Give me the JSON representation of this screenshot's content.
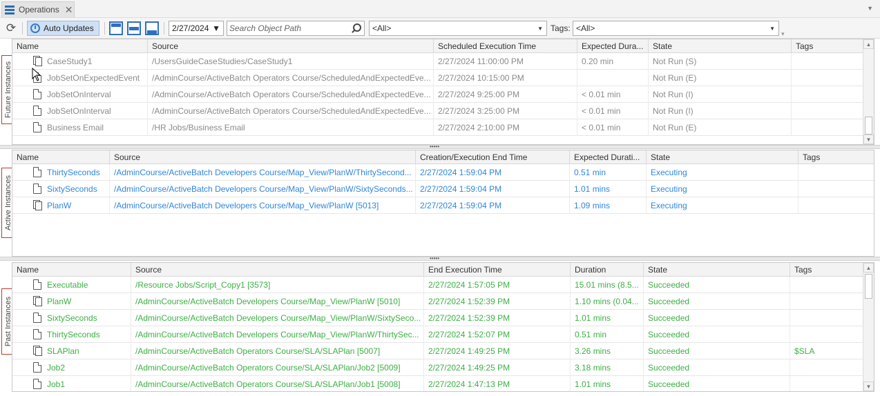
{
  "tab": {
    "title": "Operations",
    "close": "✕"
  },
  "toolbar": {
    "refresh_icon": "refresh-icon",
    "auto_updates_label": "Auto Updates",
    "date_value": "2/27/2024",
    "search_placeholder": "Search Object Path",
    "filter_value": "<All>",
    "tags_label": "Tags:",
    "tags_value": "<All>"
  },
  "future": {
    "label": "Future Instances",
    "columns": [
      "Name",
      "Source",
      "Scheduled Execution Time",
      "Expected Dura...",
      "State",
      "Tags"
    ],
    "rows": [
      {
        "icon": "plan",
        "name": "CaseStudy1",
        "source": "/UsersGuideCaseStudies/CaseStudy1",
        "time": "2/27/2024 11:00:00 PM",
        "duration": "0.20 min",
        "state": "Not Run (S)",
        "tags": ""
      },
      {
        "icon": "job",
        "name": "JobSetOnExpectedEvent",
        "source": "/AdminCourse/ActiveBatch Operators Course/ScheduledAndExpectedEve...",
        "time": "2/27/2024 10:15:00 PM",
        "duration": "",
        "state": "Not Run (E)",
        "tags": ""
      },
      {
        "icon": "job",
        "name": "JobSetOnInterval",
        "source": "/AdminCourse/ActiveBatch Operators Course/ScheduledAndExpectedEve...",
        "time": "2/27/2024 9:25:00 PM",
        "duration": "< 0.01 min",
        "state": "Not Run (I)",
        "tags": ""
      },
      {
        "icon": "job",
        "name": "JobSetOnInterval",
        "source": "/AdminCourse/ActiveBatch Operators Course/ScheduledAndExpectedEve...",
        "time": "2/27/2024 3:25:00 PM",
        "duration": "< 0.01 min",
        "state": "Not Run (I)",
        "tags": ""
      },
      {
        "icon": "job",
        "name": "Business Email",
        "source": "/HR Jobs/Business Email",
        "time": "2/27/2024 2:10:00 PM",
        "duration": "< 0.01 min",
        "state": "Not Run (E)",
        "tags": ""
      }
    ]
  },
  "active": {
    "label": "Active Instances",
    "columns": [
      "Name",
      "Source",
      "Creation/Execution End Time",
      "Expected Durati...",
      "State",
      "Tags"
    ],
    "rows": [
      {
        "icon": "job",
        "name": "ThirtySeconds",
        "source": "/AdminCourse/ActiveBatch Developers Course/Map_View/PlanW/ThirtySecond...",
        "time": "2/27/2024 1:59:04 PM",
        "duration": "0.51 min",
        "state": "Executing",
        "tags": ""
      },
      {
        "icon": "job",
        "name": "SixtySeconds",
        "source": "/AdminCourse/ActiveBatch Developers Course/Map_View/PlanW/SixtySeconds...",
        "time": "2/27/2024 1:59:04 PM",
        "duration": "1.01 mins",
        "state": "Executing",
        "tags": ""
      },
      {
        "icon": "plan",
        "name": "PlanW",
        "source": "/AdminCourse/ActiveBatch Developers Course/Map_View/PlanW [5013]",
        "time": "2/27/2024 1:59:04 PM",
        "duration": "1.09 mins",
        "state": "Executing",
        "tags": ""
      }
    ]
  },
  "past": {
    "label": "Past Instances",
    "columns": [
      "Name",
      "Source",
      "End Execution Time",
      "Duration",
      "State",
      "Tags"
    ],
    "rows": [
      {
        "icon": "job",
        "name": "Executable",
        "source": "/Resource Jobs/Script_Copy1 [3573]",
        "time": "2/27/2024 1:57:05 PM",
        "duration": "15.01 mins (8.5...",
        "state": "Succeeded",
        "tags": ""
      },
      {
        "icon": "plan",
        "name": "PlanW",
        "source": "/AdminCourse/ActiveBatch Developers Course/Map_View/PlanW [5010]",
        "time": "2/27/2024 1:52:39 PM",
        "duration": "1.10 mins (0.04...",
        "state": "Succeeded",
        "tags": ""
      },
      {
        "icon": "job",
        "name": "SixtySeconds",
        "source": "/AdminCourse/ActiveBatch Developers Course/Map_View/PlanW/SixtySeco...",
        "time": "2/27/2024 1:52:39 PM",
        "duration": "1.01 mins",
        "state": "Succeeded",
        "tags": ""
      },
      {
        "icon": "job",
        "name": "ThirtySeconds",
        "source": "/AdminCourse/ActiveBatch Developers Course/Map_View/PlanW/ThirtySec...",
        "time": "2/27/2024 1:52:07 PM",
        "duration": "0.51 min",
        "state": "Succeeded",
        "tags": ""
      },
      {
        "icon": "plan",
        "name": "SLAPlan",
        "source": "/AdminCourse/ActiveBatch Operators Course/SLA/SLAPlan [5007]",
        "time": "2/27/2024 1:49:25 PM",
        "duration": "3.26 mins",
        "state": "Succeeded",
        "tags": "$SLA"
      },
      {
        "icon": "job",
        "name": "Job2",
        "source": "/AdminCourse/ActiveBatch Operators Course/SLA/SLAPlan/Job2 [5009]",
        "time": "2/27/2024 1:49:25 PM",
        "duration": "3.18 mins",
        "state": "Succeeded",
        "tags": ""
      },
      {
        "icon": "job",
        "name": "Job1",
        "source": "/AdminCourse/ActiveBatch Operators Course/SLA/SLAPlan/Job1 [5008]",
        "time": "2/27/2024 1:47:13 PM",
        "duration": "1.01 mins",
        "state": "Succeeded",
        "tags": ""
      }
    ]
  },
  "colors": {
    "future_text": "#8a8a8a",
    "active_text": "#2e86de",
    "past_text": "#3cb043",
    "label_border": "#c0392b"
  }
}
